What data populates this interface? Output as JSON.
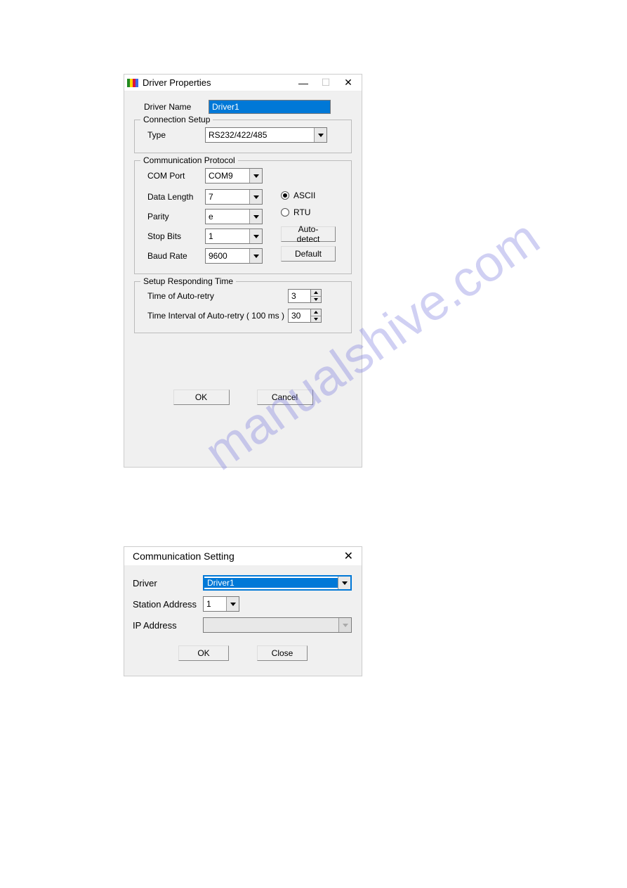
{
  "watermark": "manualshive.com",
  "dialog1": {
    "title": "Driver Properties",
    "driver_name_label": "Driver Name",
    "driver_name_value": "Driver1",
    "connection_setup": {
      "legend": "Connection Setup",
      "type_label": "Type",
      "type_value": "RS232/422/485"
    },
    "comm_protocol": {
      "legend": "Communication Protocol",
      "com_port_label": "COM Port",
      "com_port_value": "COM9",
      "data_length_label": "Data Length",
      "data_length_value": "7",
      "parity_label": "Parity",
      "parity_value": "e",
      "stop_bits_label": "Stop Bits",
      "stop_bits_value": "1",
      "baud_rate_label": "Baud Rate",
      "baud_rate_value": "9600",
      "ascii_label": "ASCII",
      "rtu_label": "RTU",
      "auto_detect": "Auto-detect",
      "default": "Default"
    },
    "responding": {
      "legend": "Setup Responding Time",
      "auto_retry_label": "Time of Auto-retry",
      "auto_retry_value": "3",
      "interval_label": "Time Interval of Auto-retry ( 100 ms )",
      "interval_value": "30"
    },
    "ok": "OK",
    "cancel": "Cancel"
  },
  "dialog2": {
    "title": "Communication Setting",
    "driver_label": "Driver",
    "driver_value": "Driver1",
    "station_label": "Station Address",
    "station_value": "1",
    "ip_label": "IP Address",
    "ip_value": "",
    "ok": "OK",
    "close": "Close"
  }
}
